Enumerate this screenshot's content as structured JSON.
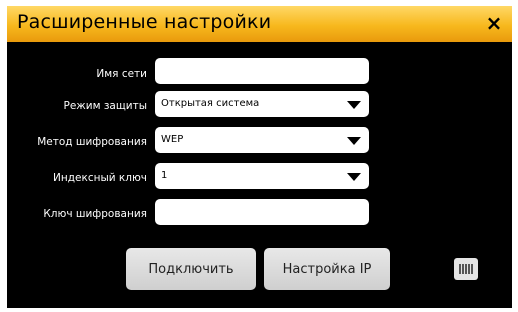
{
  "dialog": {
    "title": "Расширенные настройки",
    "close_glyph": "×"
  },
  "form": {
    "network_name": {
      "label": "Имя сети",
      "value": ""
    },
    "security_mode": {
      "label": "Режим защиты",
      "value": "Открытая система"
    },
    "encryption_method": {
      "label": "Метод шифрования",
      "value": "WEP"
    },
    "key_index": {
      "label": "Индексный ключ",
      "value": "1"
    },
    "encryption_key": {
      "label": "Ключ шифрования",
      "value": ""
    }
  },
  "buttons": {
    "connect": "Подключить",
    "ip_settings": "Настройка IP"
  },
  "icons": {
    "close": "close-icon",
    "keyboard": "keyboard-icon",
    "dropdown": "chevron-down-icon"
  },
  "colors": {
    "titlebar": "#f7b81d",
    "background": "#000000",
    "button": "#d9d9d9"
  }
}
